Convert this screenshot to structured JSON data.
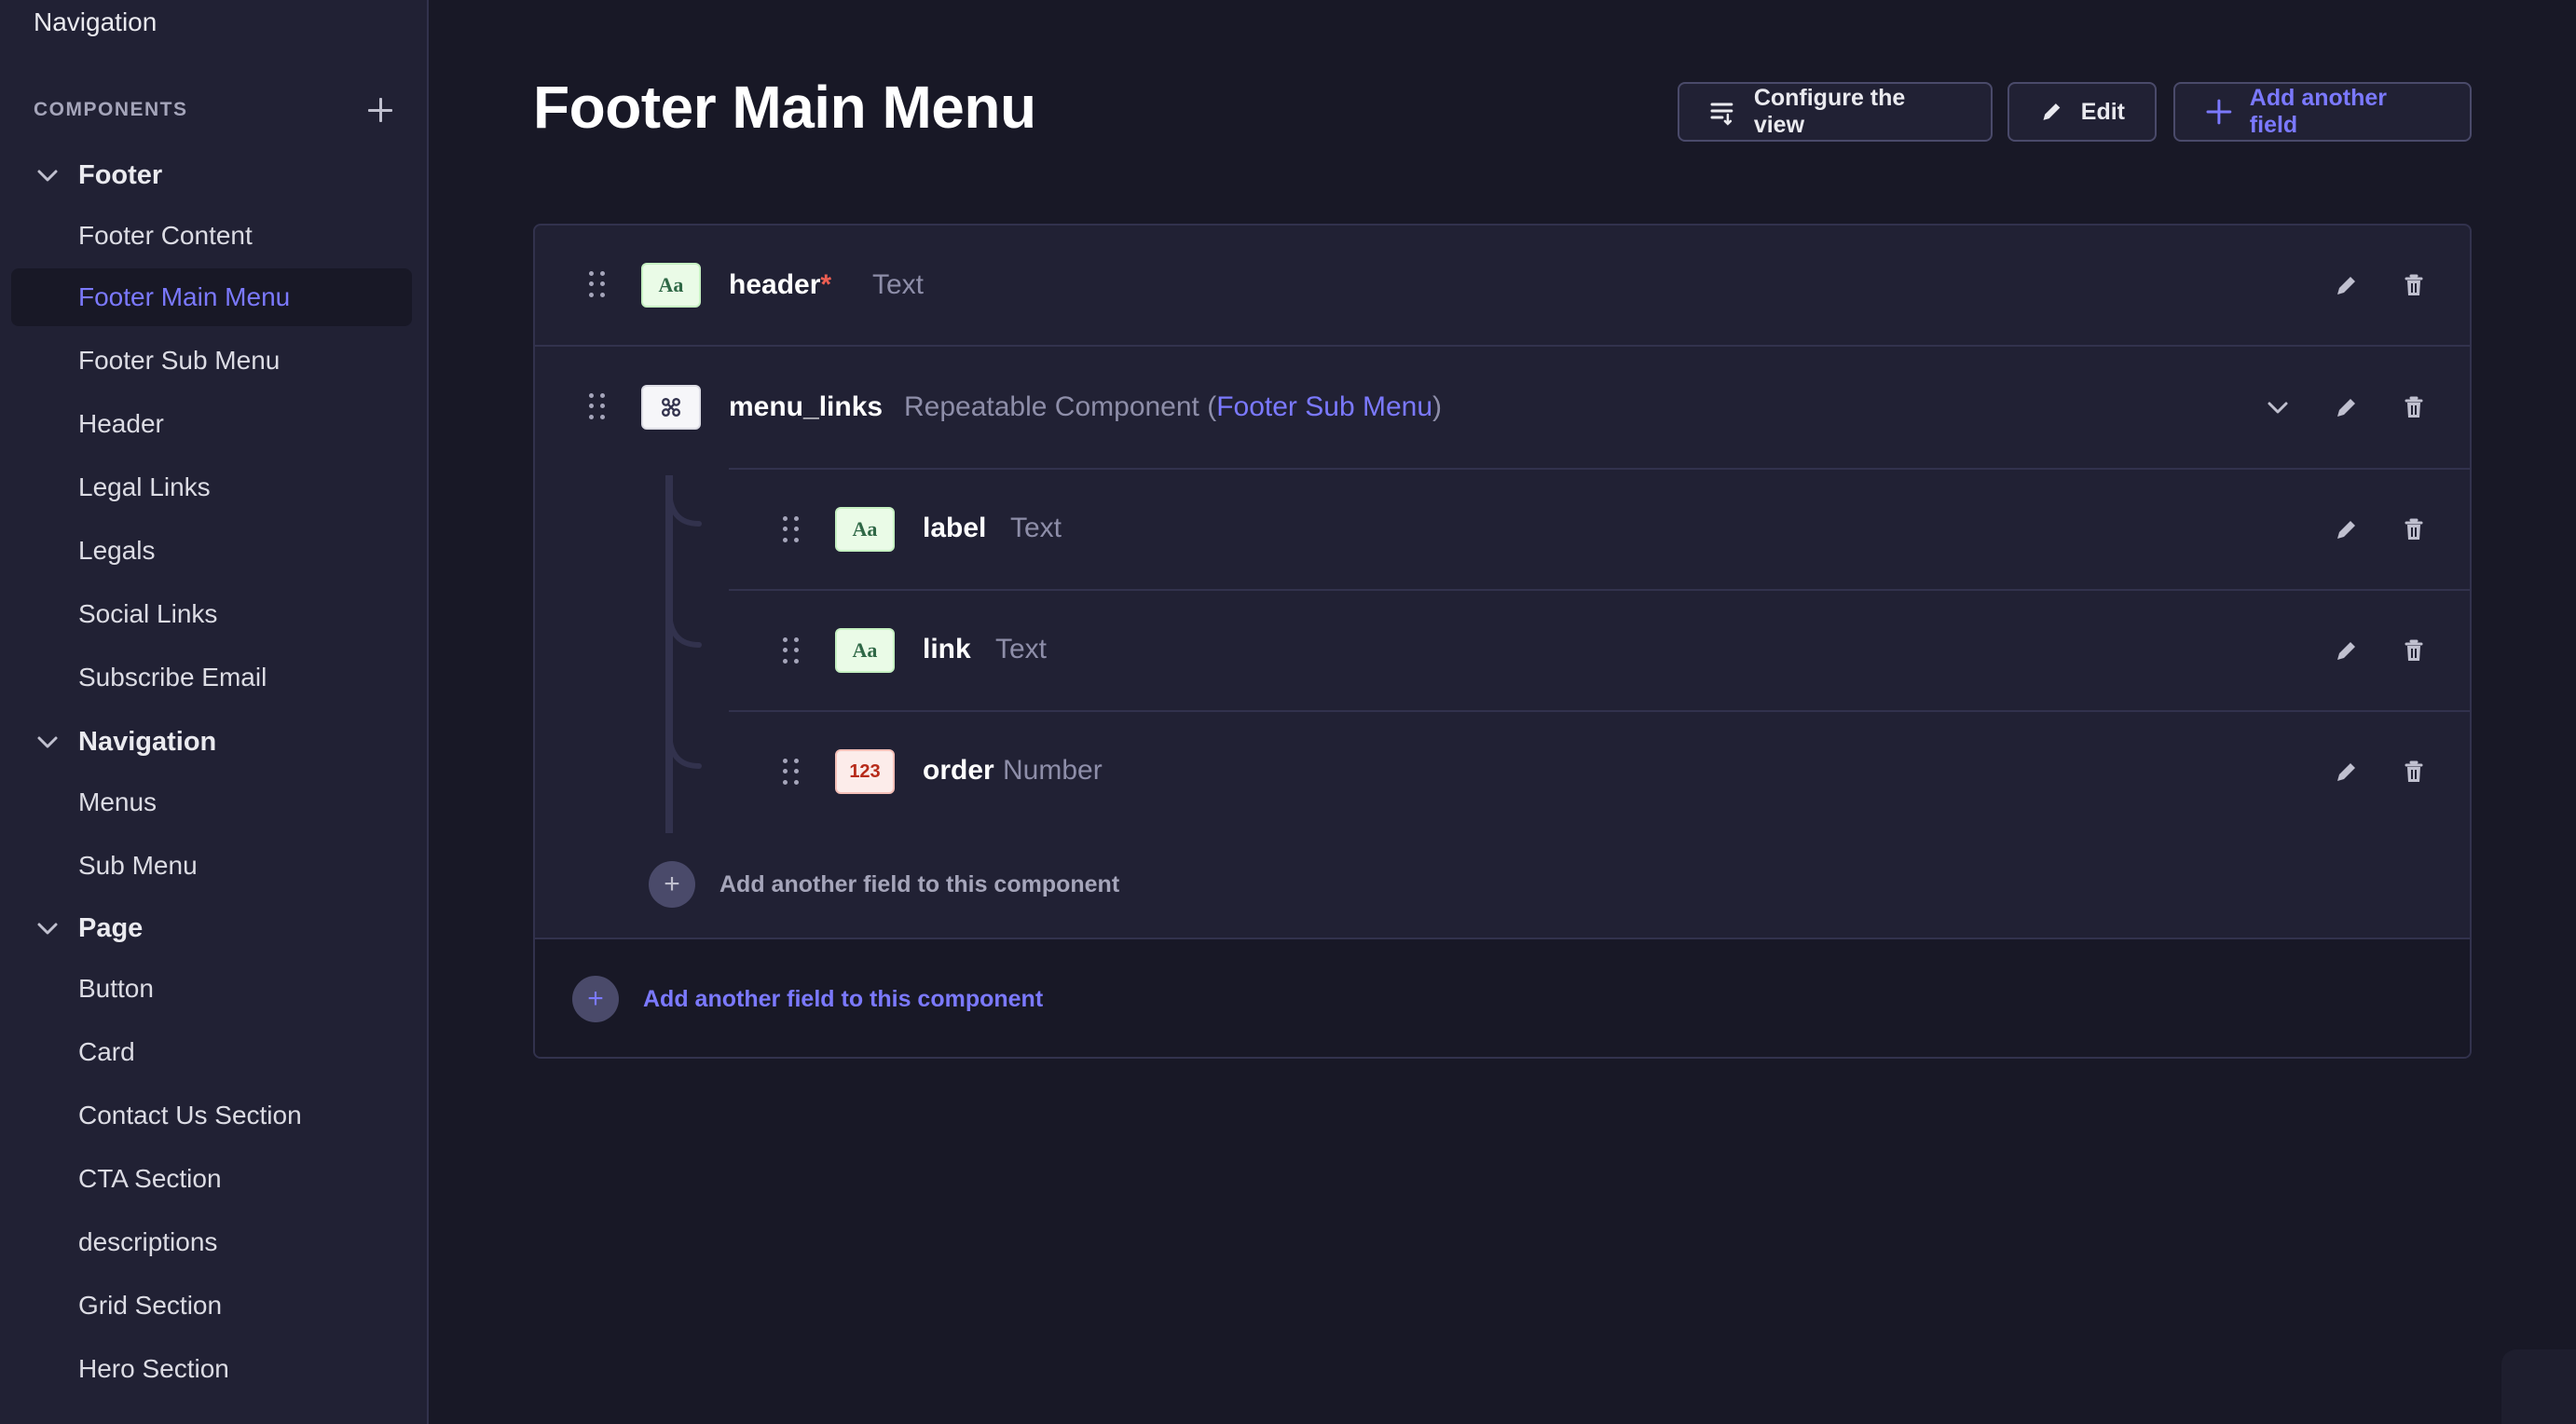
{
  "sidebar": {
    "top_label": "Navigation",
    "section_title": "COMPONENTS",
    "groups": [
      {
        "label": "Footer",
        "items": [
          "Footer Content",
          "Footer Main Menu",
          "Footer Sub Menu",
          "Header",
          "Legal Links",
          "Legals",
          "Social Links",
          "Subscribe Email"
        ]
      },
      {
        "label": "Navigation",
        "items": [
          "Menus",
          "Sub Menu"
        ]
      },
      {
        "label": "Page",
        "items": [
          "Button",
          "Card",
          "Contact Us Section",
          "CTA Section",
          "descriptions",
          "Grid Section",
          "Hero Section"
        ]
      }
    ],
    "active_item": "Footer Main Menu"
  },
  "header": {
    "title": "Footer Main Menu",
    "configure_label": "Configure the view",
    "edit_label": "Edit",
    "add_field_label": "Add another field"
  },
  "fields": [
    {
      "name": "header",
      "required_mark": "*",
      "type": "Text",
      "badge": "Aa"
    },
    {
      "name": "menu_links",
      "type_prefix": "Repeatable Component (",
      "type_link": "Footer Sub Menu",
      "type_suffix": ")",
      "badge": "component-icon"
    }
  ],
  "sub_fields": [
    {
      "name": "label",
      "type": "Text",
      "badge": "Aa"
    },
    {
      "name": "link",
      "type": "Text",
      "badge": "Aa"
    },
    {
      "name": "order",
      "type": "Number",
      "badge": "123"
    }
  ],
  "add_inner_label": "Add another field to this component",
  "add_outer_label": "Add another field to this component",
  "colors": {
    "background": "#181826",
    "sidebar": "#212134",
    "accent": "#7b79ff",
    "border": "#32324d"
  }
}
